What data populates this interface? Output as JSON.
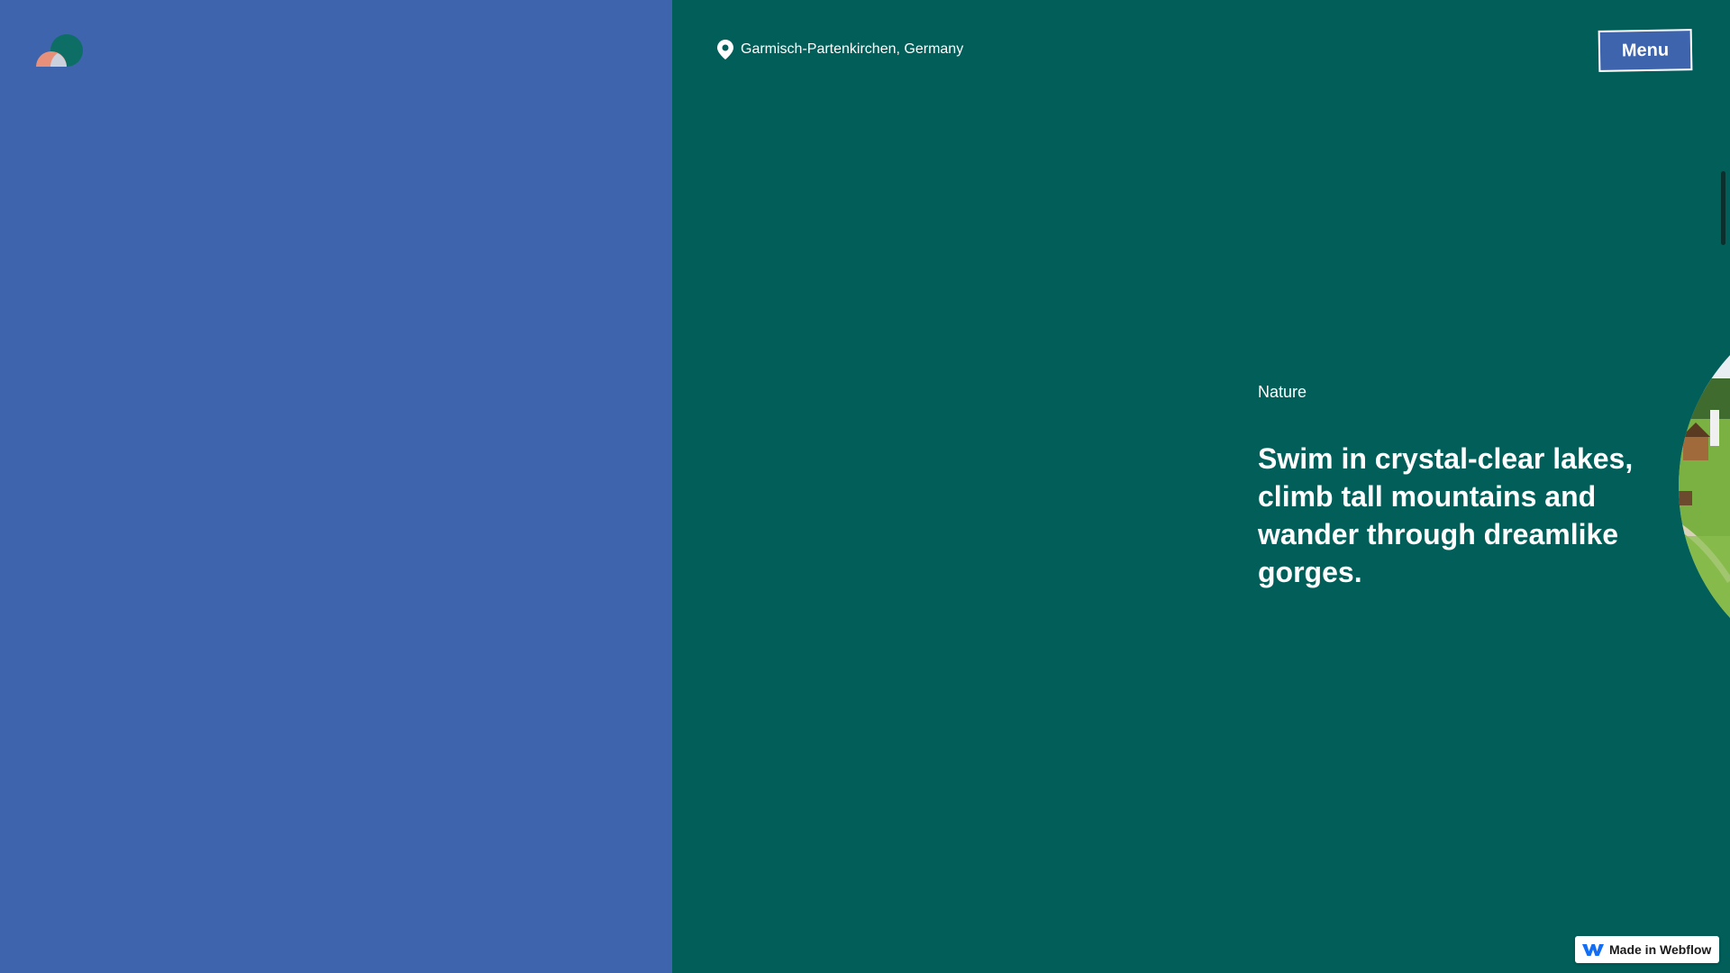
{
  "header": {
    "location": "Garmisch-Partenkirchen, Germany",
    "menu_label": "Menu"
  },
  "icons": {
    "logo": "logo-icon",
    "location": "map-pin-icon",
    "webflow": "webflow-icon"
  },
  "content": {
    "category": "Nature",
    "headline": "Swim in crystal-clear lakes, climb tall mountains and wander through dreamlike gorges."
  },
  "badge": {
    "label": "Made in Webflow"
  },
  "colors": {
    "left_panel": "#3d64ad",
    "right_panel": "#015e59",
    "logo_teal": "#0d6e66",
    "logo_coral": "#e8907a",
    "text": "#ffffff",
    "webflow_blue": "#146ef5"
  }
}
